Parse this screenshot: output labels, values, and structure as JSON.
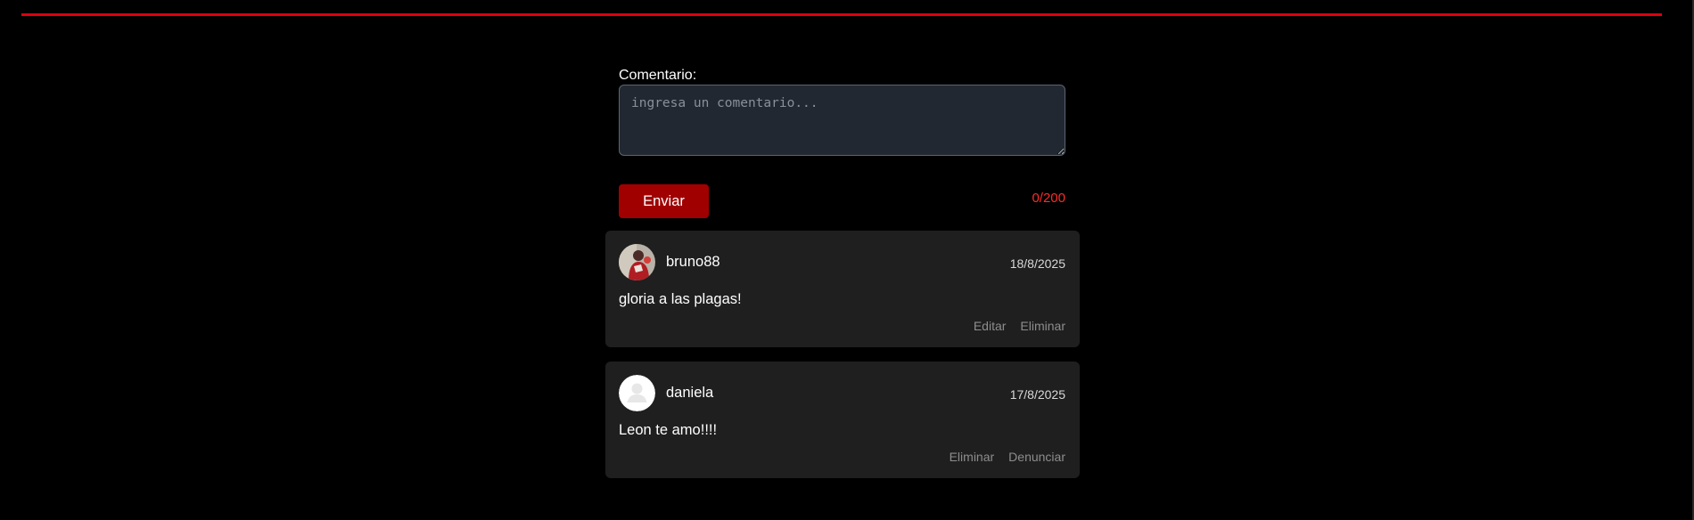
{
  "form": {
    "label": "Comentario:",
    "input_value": "",
    "placeholder": "ingresa un comentario...",
    "send_label": "Enviar",
    "char_count": "0/200"
  },
  "comments": [
    {
      "username": "bruno88",
      "date": "18/8/2025",
      "text": "gloria a las plagas!",
      "avatar_icon": "user-photo-avatar",
      "actions": [
        "Editar",
        "Eliminar"
      ]
    },
    {
      "username": "daniela",
      "date": "17/8/2025",
      "text": "Leon te amo!!!!",
      "avatar_icon": "default-user-icon",
      "actions": [
        "Eliminar",
        "Denunciar"
      ]
    }
  ],
  "colors": {
    "background": "#000000",
    "accent_line": "#e0000d",
    "send_button": "#a00000",
    "char_count": "#ff2a2a",
    "card": "#1f1f1f",
    "input_bg": "#222831",
    "action_text": "#8d8d8d"
  }
}
